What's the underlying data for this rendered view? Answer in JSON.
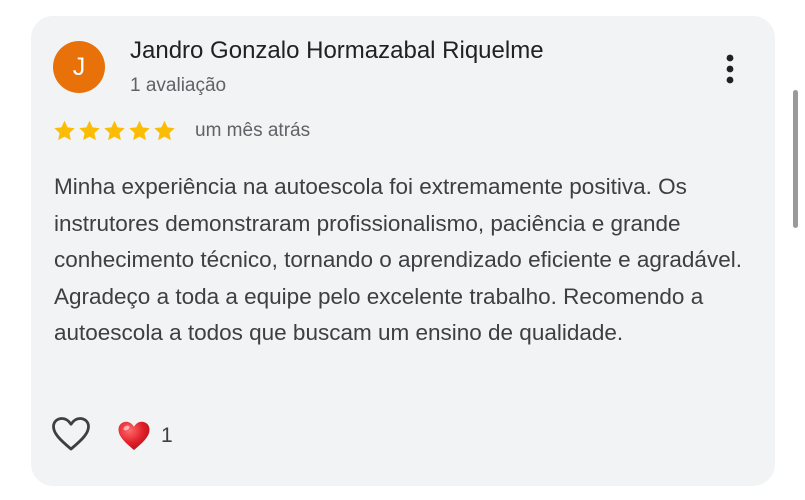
{
  "review": {
    "author": {
      "initial": "J",
      "name": "Jandro Gonzalo Hormazabal Riquelme",
      "review_count": "1 avaliação",
      "avatar_color": "#e8710a"
    },
    "rating": {
      "stars": 5,
      "max": 5,
      "star_color": "#fbbc04"
    },
    "time_ago": "um mês atrás",
    "text": "Minha experiência na autoescola foi extremamente positiva. Os instrutores demonstraram profissionalismo, paciência e grande conhecimento técnico, tornando o aprendizado eficiente e agradável. Agradeço a toda a equipe pelo excelente trabalho. Recomendo a autoescola a todos que buscam um ensino de qualidade.",
    "reactions": {
      "like_icon": "heart-outline-icon",
      "reaction_icon": "red-heart-icon",
      "count": "1"
    },
    "menu_icon": "more-vertical-icon"
  }
}
